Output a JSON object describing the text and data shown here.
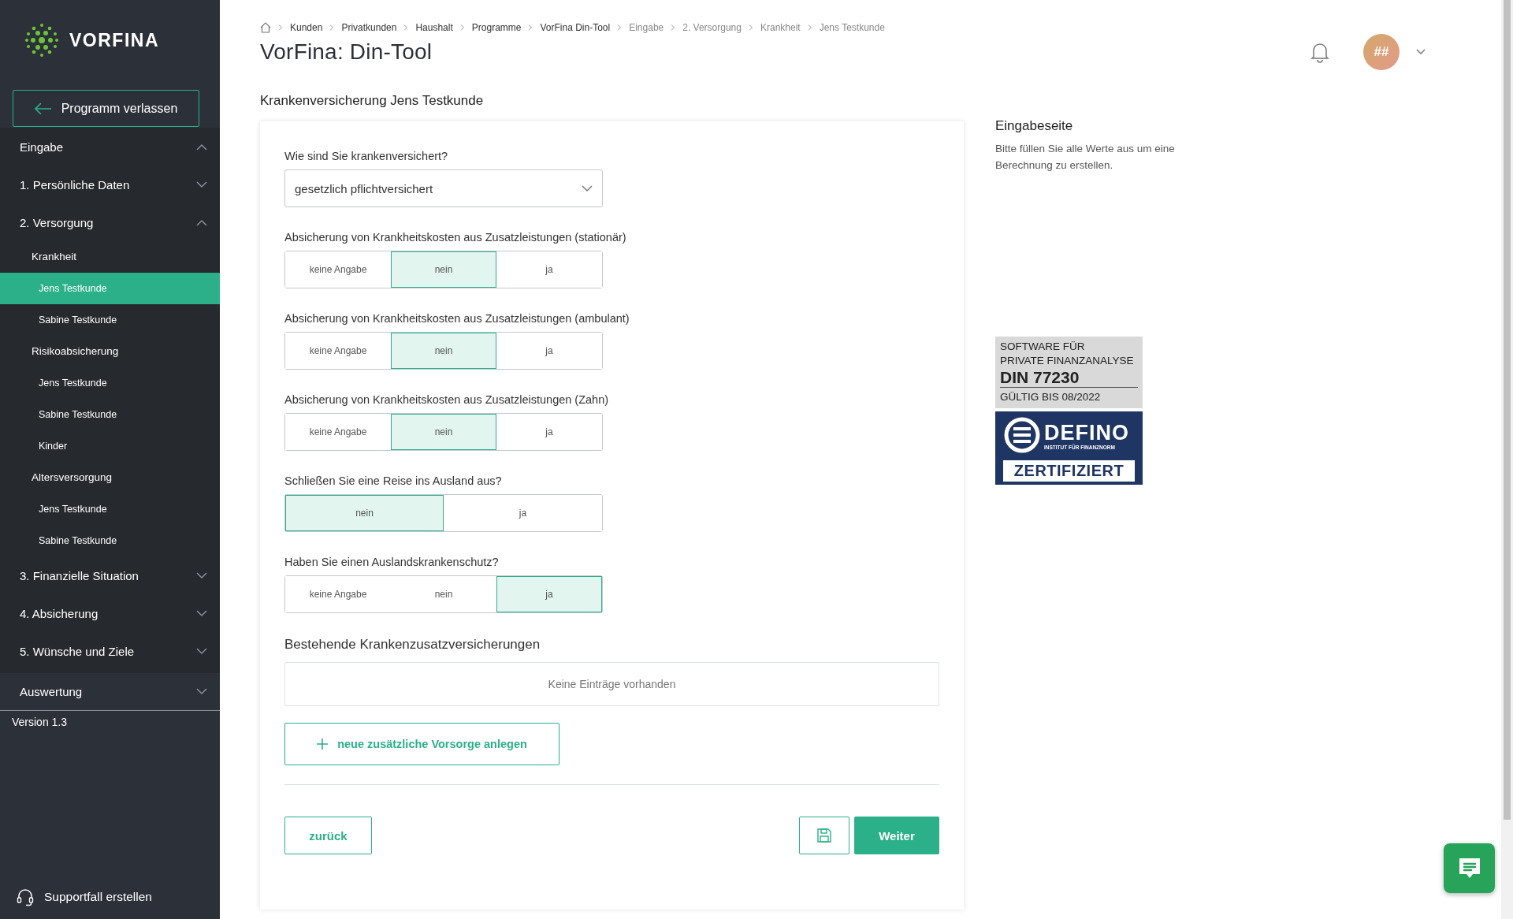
{
  "sidebar": {
    "logo": {
      "text": "VORFINA"
    },
    "exit_button": {
      "label": "Programm verlassen"
    },
    "sections": [
      {
        "label": "Eingabe",
        "expanded": true,
        "kind": "section"
      },
      {
        "label": "1. Persönliche Daten",
        "expanded": false,
        "kind": "section"
      },
      {
        "label": "2. Versorgung",
        "expanded": true,
        "kind": "section",
        "children": [
          {
            "label": "Krankheit",
            "selected": false,
            "children": [
              {
                "label": "Jens Testkunde",
                "selected": true
              },
              {
                "label": "Sabine Testkunde",
                "selected": false
              }
            ]
          },
          {
            "label": "Risikoabsicherung",
            "selected": false,
            "children": [
              {
                "label": "Jens Testkunde",
                "selected": false
              },
              {
                "label": "Sabine Testkunde",
                "selected": false
              },
              {
                "label": "Kinder",
                "selected": false
              }
            ]
          },
          {
            "label": "Altersversorgung",
            "selected": false,
            "children": [
              {
                "label": "Jens Testkunde",
                "selected": false
              },
              {
                "label": "Sabine Testkunde",
                "selected": false
              }
            ]
          }
        ]
      },
      {
        "label": "3. Finanzielle Situation",
        "expanded": false,
        "kind": "section"
      },
      {
        "label": "4. Absicherung",
        "expanded": false,
        "kind": "section"
      },
      {
        "label": "5. Wünsche und Ziele",
        "expanded": false,
        "kind": "section"
      },
      {
        "label": "Auswertung",
        "expanded": false,
        "kind": "summary"
      }
    ],
    "version": "Version 1.3",
    "support_link": "Supportfall erstellen"
  },
  "breadcrumb": [
    {
      "label": "Kunden",
      "kind": "link"
    },
    {
      "label": "Privatkunden",
      "kind": "link"
    },
    {
      "label": "Haushalt",
      "kind": "link"
    },
    {
      "label": "Programme",
      "kind": "link"
    },
    {
      "label": "VorFina Din-Tool",
      "kind": "link"
    },
    {
      "label": "Eingabe",
      "kind": "step"
    },
    {
      "label": "2. Versorgung",
      "kind": "step"
    },
    {
      "label": "Krankheit",
      "kind": "step"
    },
    {
      "label": "Jens Testkunde",
      "kind": "step"
    }
  ],
  "page_title": "VorFina: Din-Tool",
  "header": {
    "avatar": "##"
  },
  "section_title": "Krankenversicherung Jens Testkunde",
  "form": {
    "questions": [
      {
        "kind": "select",
        "label": "Wie sind Sie krankenversichert?",
        "value": "gesetzlich pflichtversichert"
      },
      {
        "kind": "segmented",
        "label": "Absicherung von Krankheitskosten aus Zusatzleistungen (stationär)",
        "options": [
          {
            "label": "keine Angabe",
            "selected": false
          },
          {
            "label": "nein",
            "selected": true
          },
          {
            "label": "ja",
            "selected": false
          }
        ]
      },
      {
        "kind": "segmented",
        "label": "Absicherung von Krankheitskosten aus Zusatzleistungen (ambulant)",
        "options": [
          {
            "label": "keine Angabe",
            "selected": false
          },
          {
            "label": "nein",
            "selected": true
          },
          {
            "label": "ja",
            "selected": false
          }
        ]
      },
      {
        "kind": "segmented",
        "label": "Absicherung von Krankheitskosten aus Zusatzleistungen (Zahn)",
        "options": [
          {
            "label": "keine Angabe",
            "selected": false
          },
          {
            "label": "nein",
            "selected": true
          },
          {
            "label": "ja",
            "selected": false
          }
        ]
      },
      {
        "kind": "segmented",
        "label": "Schließen Sie eine Reise ins Ausland aus?",
        "options": [
          {
            "label": "nein",
            "selected": true
          },
          {
            "label": "ja",
            "selected": false
          }
        ]
      },
      {
        "kind": "segmented",
        "label": "Haben Sie einen Auslandskrankenschutz?",
        "options": [
          {
            "label": "keine Angabe",
            "selected": false
          },
          {
            "label": "nein",
            "selected": false
          },
          {
            "label": "ja",
            "selected": true
          }
        ]
      }
    ],
    "existing": {
      "title": "Bestehende Krankenzusatzversicherungen",
      "empty_text": "Keine Einträge vorhanden",
      "add_button": "neue zusätzliche Vorsorge anlegen"
    },
    "back_button": "zurück",
    "next_button": "Weiter"
  },
  "info": {
    "title": "Eingabeseite",
    "text": "Bitte füllen Sie alle Werte aus um eine Berechnung zu erstellen."
  },
  "badge": {
    "lines": [
      "SOFTWARE FÜR",
      "PRIVATE FINANZANALYSE"
    ],
    "norm": "DIN 77230",
    "validity": "GÜLTIG BIS 08/2022",
    "brand": "DEFINO",
    "brand_sub": "INSTITUT FÜR FINANZNORM",
    "certified": "ZERTIFIZIERT"
  }
}
